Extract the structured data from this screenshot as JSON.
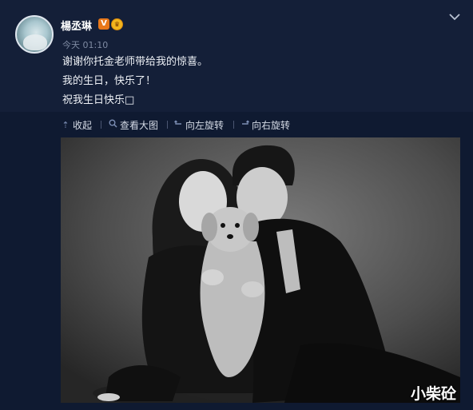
{
  "post": {
    "username": "楊丞琳",
    "verified_badge": "V",
    "vip_badge_icon": "vip-crown-icon",
    "timestamp": "今天 01:10",
    "lines": [
      "谢谢你托金老师带给我的惊喜。",
      "我的生日，快乐了！",
      "祝我生日快乐□"
    ]
  },
  "toolbar": {
    "collapse_label": "收起",
    "view_large_label": "查看大图",
    "rotate_left_label": "向左旋转",
    "rotate_right_label": "向右旋转"
  },
  "photo": {
    "description_icon": "couple-with-dog-photo"
  },
  "watermark": "小柴砼",
  "colors": {
    "background": "#0f1a31",
    "header": "#141f38",
    "accent_icon": "#7b8db3",
    "verified_orange": "#e8781a"
  }
}
